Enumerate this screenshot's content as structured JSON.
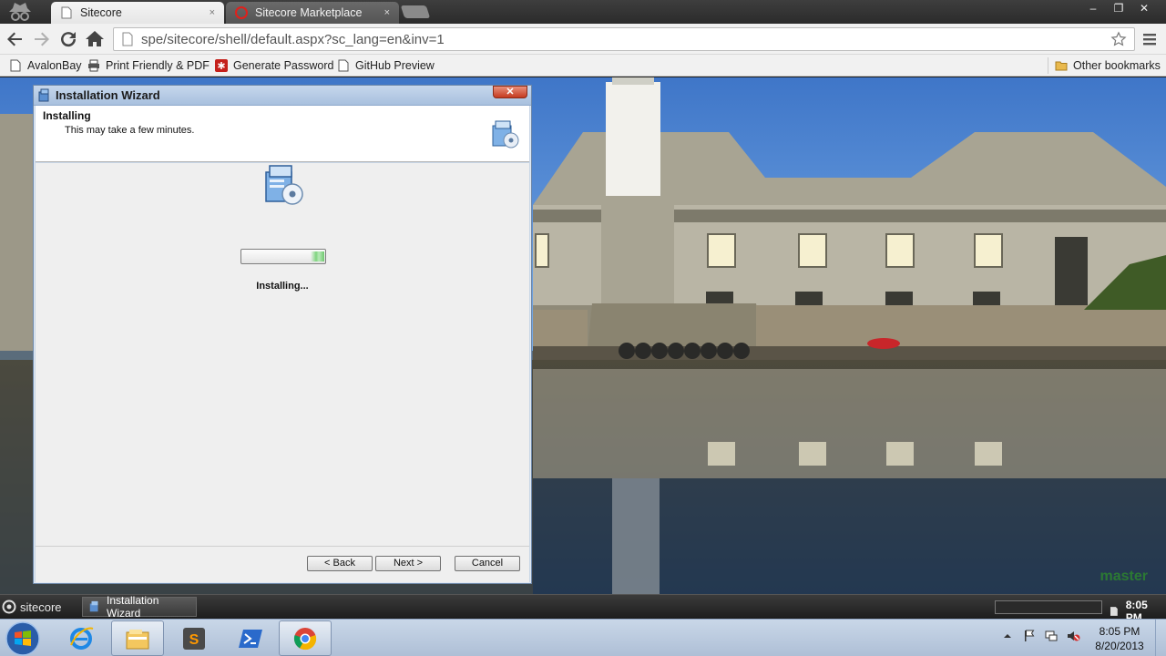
{
  "browser": {
    "tabs": [
      {
        "label": "Sitecore",
        "close": "×"
      },
      {
        "label": "Sitecore Marketplace",
        "close": "×"
      }
    ],
    "window_controls": {
      "minimize": "–",
      "restore": "❐",
      "close": "✕"
    },
    "address": "spe/sitecore/shell/default.aspx?sc_lang=en&inv=1",
    "bookmarks": [
      "AvalonBay",
      "Print Friendly & PDF",
      "Generate Password",
      "GitHub Preview"
    ],
    "other_bookmarks": "Other bookmarks",
    "icons": [
      "incognito-icon",
      "back-icon",
      "forward-icon",
      "reload-icon",
      "home-icon",
      "star-icon",
      "menu-icon",
      "folder-icon"
    ]
  },
  "wizard": {
    "title": "Installation Wizard",
    "close_glyph": "✕",
    "heading": "Installing",
    "subheading": "This may take a few minutes.",
    "status": "Installing...",
    "progress": 0.17,
    "buttons": {
      "back": "< Back",
      "next": "Next >",
      "cancel": "Cancel"
    }
  },
  "sitecore_taskbar": {
    "logo": "sitecore",
    "task": "Installation Wizard",
    "time": "8:05 PM"
  },
  "windows_taskbar": {
    "pinned": [
      "ie-icon",
      "explorer-icon",
      "sublime-icon",
      "powershell-icon",
      "chrome-icon"
    ],
    "time": "8:05 PM",
    "date": "8/20/2013"
  },
  "desktop": {
    "watermark": "master"
  },
  "colors": {
    "chrome_bg": "#f1f1f1",
    "wizard_frame": "#c8d6e6",
    "taskbar": "#aebfd6",
    "progress": "#7fd47f"
  }
}
